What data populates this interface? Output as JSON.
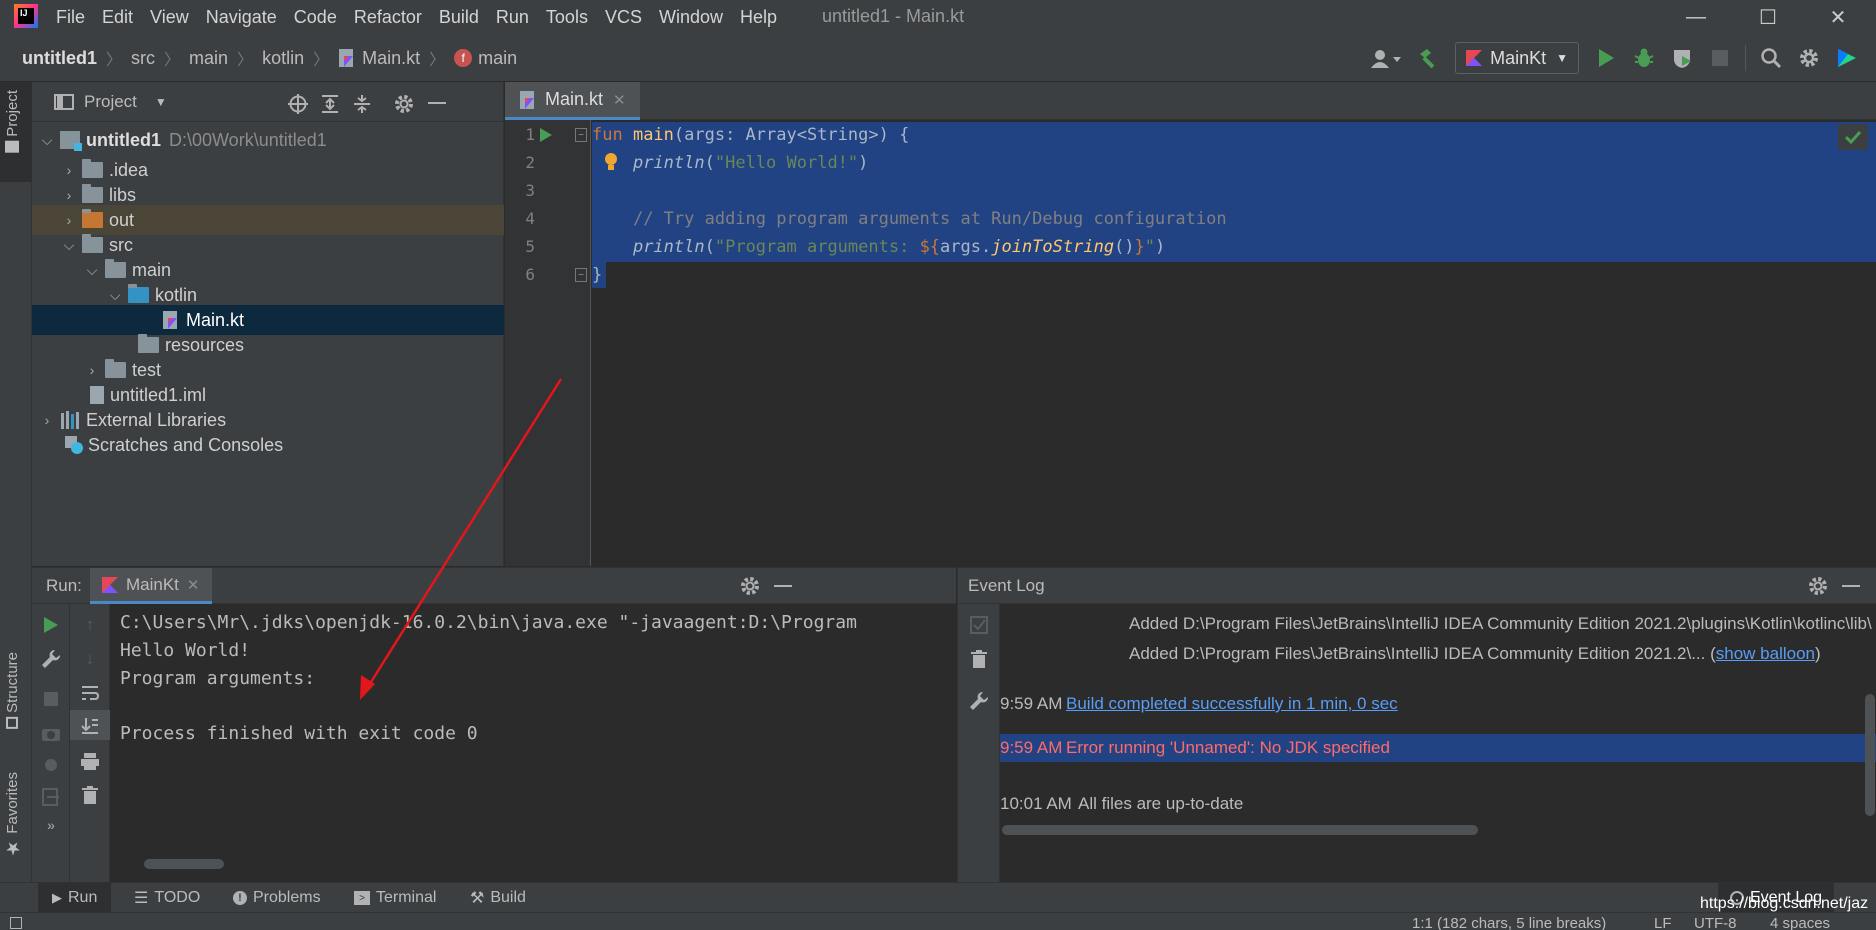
{
  "menubar": {
    "items": [
      "File",
      "Edit",
      "View",
      "Navigate",
      "Code",
      "Refactor",
      "Build",
      "Run",
      "Tools",
      "VCS",
      "Window",
      "Help"
    ],
    "title": "untitled1 - Main.kt"
  },
  "breadcrumbs": [
    "untitled1",
    "src",
    "main",
    "kotlin",
    "Main.kt",
    "main"
  ],
  "toolbar": {
    "run_config": "MainKt"
  },
  "left_stripe": {
    "project_tab": "Project",
    "structure_tab": "Structure",
    "favorites_tab": "Favorites"
  },
  "project_panel": {
    "title": "Project",
    "root": {
      "name": "untitled1",
      "path": "D:\\00Work\\untitled1"
    },
    "items": [
      ".idea",
      "libs",
      "out",
      "src",
      "main",
      "kotlin",
      "Main.kt",
      "resources",
      "test",
      "untitled1.iml",
      "External Libraries",
      "Scratches and Consoles"
    ]
  },
  "editor": {
    "tab": "Main.kt",
    "line_numbers": [
      "1",
      "2",
      "3",
      "4",
      "5",
      "6"
    ],
    "code": {
      "l1_kw": "fun ",
      "l1_fn": "main",
      "l1_rest": "(args: Array<String>) {",
      "l2_fn": "println",
      "l2_open": "(",
      "l2_str": "\"Hello World!\"",
      "l2_close": ")",
      "l4_comment": "// Try adding program arguments at Run/Debug configuration",
      "l5_fn": "println",
      "l5_open": "(",
      "l5_str1": "\"Program arguments: ",
      "l5_tmpl": "${",
      "l5_args": "args.",
      "l5_call": "joinToString",
      "l5_parens": "()",
      "l5_tmpl_end": "}",
      "l5_str2": "\"",
      "l5_close": ")",
      "l6": "}"
    }
  },
  "run_panel": {
    "label": "Run:",
    "tab": "MainKt",
    "console": [
      "C:\\Users\\Mr\\.jdks\\openjdk-16.0.2\\bin\\java.exe \"-javaagent:D:\\Program",
      "Hello World!",
      "Program arguments: ",
      "Process finished with exit code 0"
    ]
  },
  "event_log": {
    "title": "Event Log",
    "entries": {
      "added1": "Added D:\\Program Files\\JetBrains\\IntelliJ IDEA Community Edition 2021.2\\plugins\\Kotlin\\kotlinc\\lib\\",
      "added2": "Added D:\\Program Files\\JetBrains\\IntelliJ IDEA Community Edition 2021.2\\... (",
      "show_balloon": "show balloon",
      "added2_end": ")",
      "t1": "9:59 AM",
      "m1": "Build completed successfully in 1 min, 0 sec",
      "t2": "9:59 AM",
      "m2": "Error running 'Unnamed': No JDK specified",
      "t3": "10:01 AM",
      "m3": "All files are up-to-date"
    }
  },
  "bottom_bar": {
    "tabs": [
      "Run",
      "TODO",
      "Problems",
      "Terminal",
      "Build"
    ],
    "event_log": "Event Log",
    "watermark": "https://blog.csdn.net/jaz"
  },
  "status_bar": {
    "caret": "1:1 (182 chars, 5 line breaks)",
    "line_sep": "LF",
    "encoding": "UTF-8",
    "indent": "4 spaces"
  },
  "colors": {
    "accent": "#4a88c7",
    "selection": "#214283",
    "run_green": "#499c54",
    "error": "#ff6b68",
    "annotation_red": "#e3161b"
  }
}
